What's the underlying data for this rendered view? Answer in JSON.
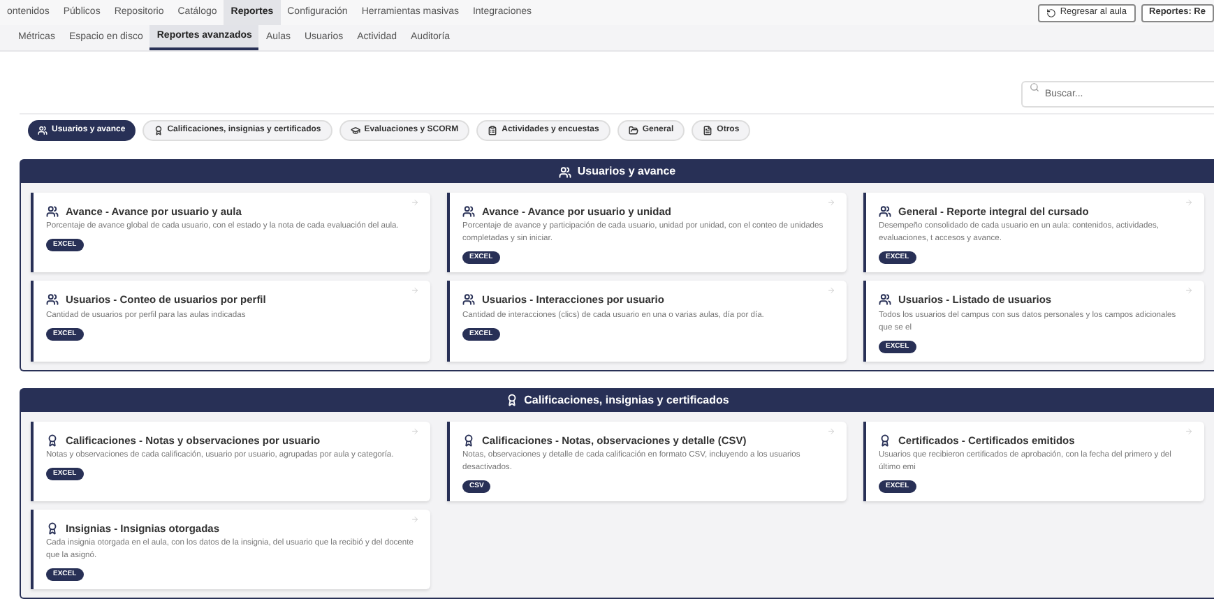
{
  "nav": [
    {
      "label": "ontenidos",
      "selected": false
    },
    {
      "label": "Públicos",
      "selected": false
    },
    {
      "label": "Repositorio",
      "selected": false
    },
    {
      "label": "Catálogo",
      "selected": false
    },
    {
      "label": "Reportes",
      "selected": true
    },
    {
      "label": "Configuración",
      "selected": false
    },
    {
      "label": "Herramientas masivas",
      "selected": false
    },
    {
      "label": "Integraciones",
      "selected": false
    }
  ],
  "header_buttons": [
    {
      "label": "Regresar al aula",
      "kind": "back"
    },
    {
      "label": "Reportes: Re",
      "kind": "plain"
    }
  ],
  "subtabs": [
    {
      "label": "Métricas",
      "selected": false
    },
    {
      "label": "Espacio en disco",
      "selected": false
    },
    {
      "label": "Reportes avanzados",
      "selected": true
    },
    {
      "label": "Aulas",
      "selected": false
    },
    {
      "label": "Usuarios",
      "selected": false
    },
    {
      "label": "Actividad",
      "selected": false
    },
    {
      "label": "Auditoría",
      "selected": false
    }
  ],
  "search": {
    "placeholder": "Buscar..."
  },
  "filters": [
    {
      "label": "Usuarios y avance",
      "kind": "users",
      "selected": true
    },
    {
      "label": "Calificaciones, insignias y certificados",
      "kind": "award",
      "selected": false
    },
    {
      "label": "Evaluaciones y SCORM",
      "kind": "graduation",
      "selected": false
    },
    {
      "label": "Actividades y encuestas",
      "kind": "clipboard",
      "selected": false
    },
    {
      "label": "General",
      "kind": "folder",
      "selected": false
    },
    {
      "label": "Otros",
      "kind": "file",
      "selected": false
    }
  ],
  "sections": [
    {
      "title": "Usuarios y avance",
      "kind": "users",
      "reports": [
        {
          "title": "Avance - Avance por usuario y aula",
          "description": "Porcentaje de avance global de cada usuario, con el estado y la nota de cada evaluación del aula.",
          "format": "EXCEL"
        },
        {
          "title": "Avance - Avance por usuario y unidad",
          "description": "Porcentaje de avance y participación de cada usuario, unidad por unidad, con el conteo de unidades completadas y sin iniciar.",
          "format": "EXCEL"
        },
        {
          "title": "General - Reporte integral del cursado",
          "description": "Desempeño consolidado de cada usuario en un aula: contenidos, actividades, evaluaciones, t accesos y avance.",
          "format": "EXCEL"
        },
        {
          "title": "Usuarios - Conteo de usuarios por perfil",
          "description": "Cantidad de usuarios por perfil para las aulas indicadas",
          "format": "EXCEL"
        },
        {
          "title": "Usuarios - Interacciones por usuario",
          "description": "Cantidad de interacciones (clics) de cada usuario en una o varias aulas, día por día.",
          "format": "EXCEL"
        },
        {
          "title": "Usuarios - Listado de usuarios",
          "description": "Todos los usuarios del campus con sus datos personales y los campos adicionales que se el",
          "format": "EXCEL"
        }
      ]
    },
    {
      "title": "Calificaciones, insignias y certificados",
      "kind": "award",
      "reports": [
        {
          "title": "Calificaciones - Notas y observaciones por usuario",
          "description": "Notas y observaciones de cada calificación, usuario por usuario, agrupadas por aula y categoría.",
          "format": "EXCEL"
        },
        {
          "title": "Calificaciones - Notas, observaciones y detalle (CSV)",
          "description": "Notas, observaciones y detalle de cada calificación en formato CSV, incluyendo a los usuarios desactivados.",
          "format": "CSV"
        },
        {
          "title": "Certificados - Certificados emitidos",
          "description": "Usuarios que recibieron certificados de aprobación, con la fecha del primero y del último emi",
          "format": "EXCEL"
        },
        {
          "title": "Insignias - Insignias otorgadas",
          "description": "Cada insignia otorgada en el aula, con los datos de la insignia, del usuario que la recibió y del docente que la asignó.",
          "format": "EXCEL"
        }
      ]
    }
  ]
}
